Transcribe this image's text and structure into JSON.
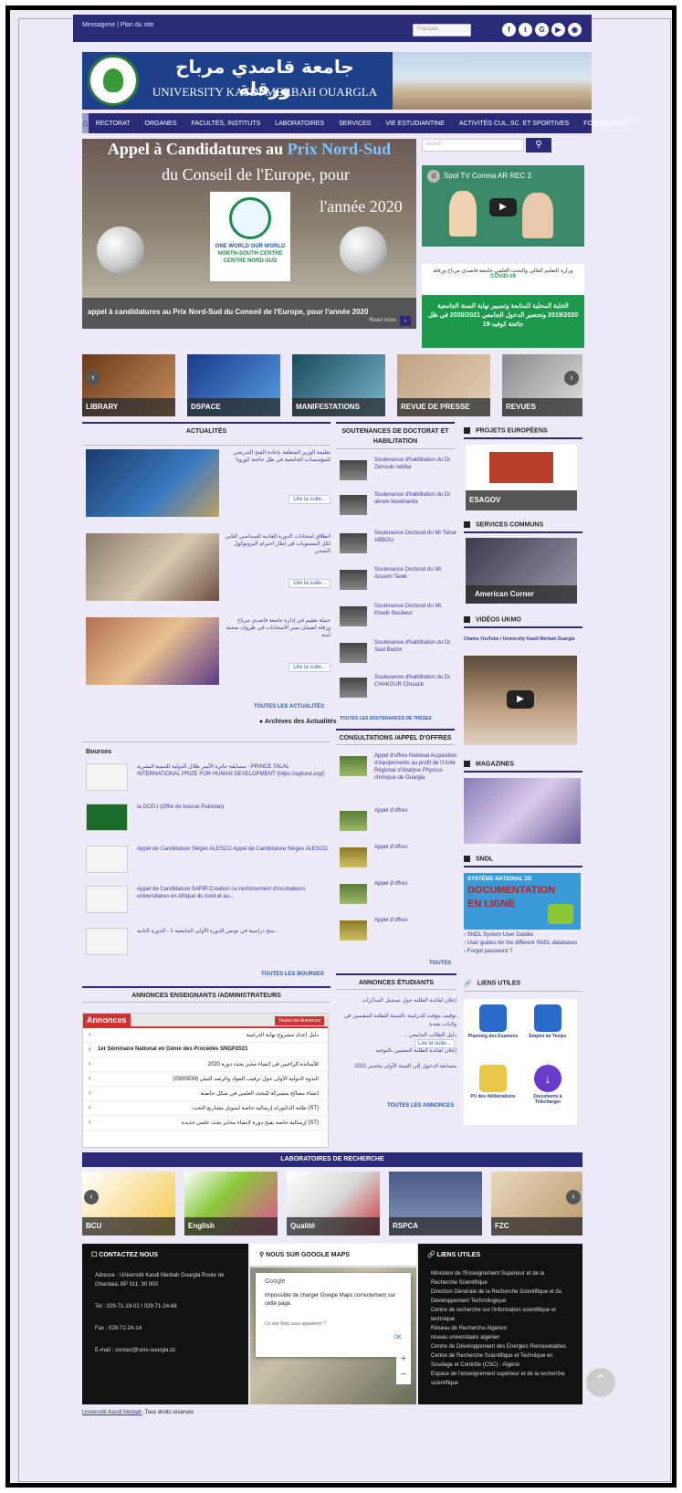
{
  "topbar": {
    "links": "Messagerie | Plan du site",
    "language": "Français",
    "social": [
      "f",
      "t",
      "G",
      "▶",
      "◉"
    ]
  },
  "banner": {
    "arabic": "جامعة قاصدي مرباح ورقلة",
    "english": "UNIVERSITY KASDI MERBAH OUARGLA"
  },
  "nav": [
    "RECTORAT",
    "ORGANES",
    "FACULTÉS, INSTITUTS",
    "LABORATOIRES",
    "SERVICES",
    "VIE ESTUDIANTINE",
    "ACTIVITÉS CUL, SC. ET SPORTIVES",
    "FORMULAIRES"
  ],
  "slide": {
    "title_a": "Appel à Candidatures au",
    "title_b": "Prix Nord-Sud",
    "title_c": "du Conseil de l'Europe, pour",
    "year": "l'année 2020",
    "badge_top": "ONE WORLD OUR WORLD",
    "badge_bottom": "NORTH-SOUTH CENTRE CENTRE NORD-SUD",
    "caption": "appel à candidatures au Prix Nord-Sud du Conseil de l'Europe, pour l'année 2020",
    "read_more": "Read more"
  },
  "search": {
    "placeholder": "search"
  },
  "video1": {
    "title": "Spot TV Corona AR REC 3",
    "avatar": "d"
  },
  "covid": {
    "header": "وزارة التعليم العالي والبحث العلمي جامعة قاصدي مرباح ورقلة",
    "sub": "COVID-19",
    "body": "الخلية المحلية للمتابعة وتسيير نهاية السنة الجامعية 2019/2020 وتحضير الدخول الجامعي 2020/2021 في ظل جائحة كوفيد-19"
  },
  "thumbs": [
    "LIBRARY",
    "DSPACE",
    "MANIFESTATIONS",
    "REVUE DE PRESSE",
    "REVUES"
  ],
  "actualites": {
    "heading": "ACTUALITÉS",
    "more": "Lire la suite...",
    "items": [
      "تعليمة الوزير المتعلقة بإعادة الفتح التدريجي للمؤسسات الجامعية في ظل جائحة كورونا",
      "انطلاق امتحانات الدورة العادية للسداسي الثاني لكل المستويات في إطار احترام البروتوكول الصحي",
      "حملة تعقيم في إدارة جامعة قاصدي مرباح ورقلة لضمان سير الامتحانات في ظروف صحية آمنة"
    ],
    "all": "TOUTES LES ACTUALITÉS",
    "archives": "Archives des Actualités"
  },
  "soutenances": {
    "heading": "SOUTENANCES DE DOCTORAT ET HABILITATION",
    "items": [
      "Soutenance d'habilitation du Dr Zerrouki rebiha",
      "Soutenance d'habilitation du Dr. akram boukhamla",
      "Soutenance Doctorat du Mr Tahar ABBOU",
      "Soutenance Doctorat du Mr. Assami Tarek",
      "Soutenance Doctorat du Mr. Khedir Boubeur",
      "Soutenance d'habilitation du Dr. Said Bachir",
      "Soutenance d'habilitation du Dr. CHAKOUR Chouaib"
    ],
    "all": "TOUTES LES SOUTENANCES DE THÈSES"
  },
  "side": {
    "projets": "PROJETS EUROPÉENS",
    "esagov": "ESAGOV",
    "services": "SERVICES COMMUNS",
    "american": "American Corner",
    "videos": "VIDÉOS UKMO",
    "chaine": "Chaîne YouTube / University Kasdi Merbah Ouargla",
    "magazines": "MAGAZINES",
    "sndl": "SNDL",
    "sndl_banner_a": "SYSTÈME NATIONAL DE",
    "sndl_banner_b": "DOCUMENTATION",
    "sndl_banner_c": "EN LIGNE",
    "sndl_links": [
      "SNDL System User Guides",
      "User guides for the different SNDL databases",
      "Forgot password ?"
    ],
    "liens": "LIENS UTILES",
    "tiles": [
      "Planning des Examens",
      "Emploi de Temps",
      "PV des délibérations",
      "Documents à Télécharger"
    ]
  },
  "bourses": {
    "heading": "Bourses",
    "items": [
      "مسابقة جائزة الأمير طلال الدولية للتنمية البشرية - PRINCE TALAL INTERNATIONAL PRIZE FOR HUMAN DEVELOPMENT (https://agfund.org/)",
      "la DCEU (Offre de bourse Pakistan)",
      "Appel de Candidature Sièges ALESCO Appel de Candidature Sièges ALESCO",
      "Appel de Candidature SAFIR Création ou renforcement d'incubateurs universitaires en Afrique du nord et au...",
      "منح دراسية في تونس الدورة الأولى الجامعية 1 - الدورة الثانية..."
    ],
    "all": "TOUTES LES BOURSES"
  },
  "consult": {
    "heading": "CONSULTATIONS /APPEL D'OFFRES",
    "items": [
      "Appel d'offres National Acquisition d'équipements au profit de l'Unité Régional d'Analyse Physico-chimique de Ouargla",
      "Appel d'offres",
      "Appel d'offres",
      "Appel d'offres",
      "Appel d'offres"
    ],
    "all": "TOUTES"
  },
  "enseignants": {
    "heading": "ANNONCES ENSEIGNANTS /ADMINISTRATEURS",
    "box_title": "Annonces",
    "box_tab": "Toutes les Annonces",
    "rows": [
      "دليل إعداد مشروع نهاية الدراسة",
      "1er Séminaire National en Génie des Procédés SNGP2021",
      "للأساتذة الراغبين في إنشاء مخبر بحث دورة 2020",
      "الندوة الدولية الأولى حول ترقيب المواد والرصد البيئي (ISMSEM)",
      "إنشاء مصالح مشتركة للبحث العلمي في شكل حاضنة",
      "(ST) طلبة الدكتوراه إرسالية خاصة لتمويل مشاريع البحث",
      "(ST) إرسالية خاصة بفتح دورة لإنشاء مخابر بحث علمي جديدة"
    ]
  },
  "etudiants": {
    "heading": "ANNONCES ÉTUDIANTS",
    "items": [
      "إعلان لفائدة الطلبة حول تسجيل المذكرات",
      "توقيف مؤقت للدراسة بالنسبة للطلبة المقيمين في ولايات بعيدة",
      "دليل الطالب الجامعي ...",
      "إعلان لفائدة الطلبة المعنيين بالتوجيه",
      "مسابقة الدخول إلى السنة الأولى ماستر 2021"
    ],
    "more": "Lire la suite...",
    "all": "TOUTES LES ANNONCES"
  },
  "labs": {
    "heading": "LABORATOIRES DE RECHERCHE",
    "items": [
      "BCU",
      "English",
      "Qualité",
      "RSPCA",
      "FZC"
    ]
  },
  "contact": {
    "heading": "CONTACTEZ NOUS",
    "address": "Adresse : Université Kasdi Merbah Ouargla Route de Ghardaia, BP 511, 30 000",
    "tel": "Tel : 029-71-19-02 / 029-71-24-66",
    "fax": "Fax : 029-71-24-14",
    "email": "E-mail : contact@univ-ouargla.dz"
  },
  "maps": {
    "heading": "NOUS SUR GOOGLE MAPS",
    "google": "Google",
    "error": "Impossible de charger Google Maps correctement sur cette page.",
    "owner": "Ce site Web vous appartient ?",
    "ok": "OK"
  },
  "footer_links": {
    "heading": "LIENS UTILES",
    "items": [
      "Ministère de l'Enseignement Supérieur et de la Recherche Scientifique",
      "Direction Générale de la Recherche Scientifique et du Développement Technologique",
      "Centre de recherche sur l'information scientifique et technique",
      "Réseau de Recherche Algérien",
      "réseau universitaire algérien",
      "Centre de Développement des Energies Renouvelables",
      "Centre de Recherche Scientifique et Technique en Soudage et Contrôle (CSC) - Algérie",
      "Espace de l'enseignement supérieur et de la recherche scientifique"
    ]
  },
  "copyright": {
    "link": "Université Kasdi Merbah",
    "text": ". Tous droits réservés"
  }
}
